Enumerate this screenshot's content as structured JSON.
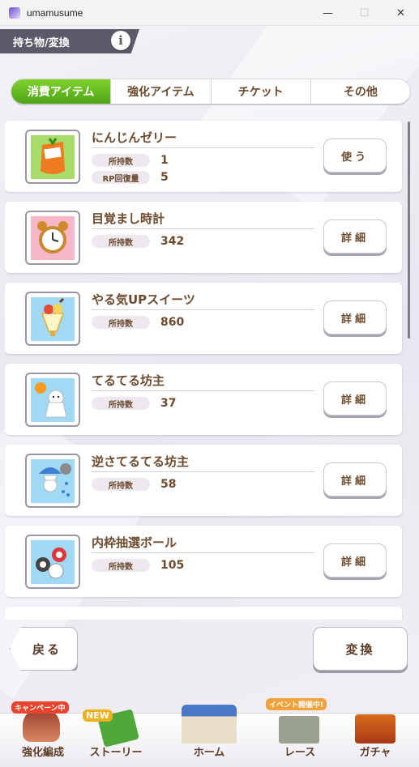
{
  "window": {
    "title": "umamusume",
    "minimize": "—",
    "maximize": "☐",
    "close": "✕"
  },
  "header": {
    "title": "持ち物/変換",
    "info": "i"
  },
  "tabs": [
    "消費アイテム",
    "強化アイテム",
    "チケット",
    "その他"
  ],
  "items": [
    {
      "name": "にんじんゼリー",
      "icon": "carrot-jelly-icon",
      "stats": [
        {
          "label": "所持数",
          "value": "1"
        },
        {
          "label": "RP回復量",
          "value": "5"
        }
      ],
      "button": "使う",
      "bg": "#a8dc6a"
    },
    {
      "name": "目覚まし時計",
      "icon": "alarm-clock-icon",
      "stats": [
        {
          "label": "所持数",
          "value": "342"
        }
      ],
      "button": "詳細",
      "bg": "#f6b7c8"
    },
    {
      "name": "やる気UPスイーツ",
      "icon": "parfait-icon",
      "stats": [
        {
          "label": "所持数",
          "value": "860"
        }
      ],
      "button": "詳細",
      "bg": "#9fd9f4"
    },
    {
      "name": "てるてる坊主",
      "icon": "teru-teru-bozu-icon",
      "stats": [
        {
          "label": "所持数",
          "value": "37"
        }
      ],
      "button": "詳細",
      "bg": "#9fd9f4"
    },
    {
      "name": "逆さてるてる坊主",
      "icon": "upside-down-teru-teru-bozu-icon",
      "stats": [
        {
          "label": "所持数",
          "value": "58"
        }
      ],
      "button": "詳細",
      "bg": "#9fd9f4"
    },
    {
      "name": "内枠抽選ボール",
      "icon": "lottery-balls-icon",
      "stats": [
        {
          "label": "所持数",
          "value": "105"
        }
      ],
      "button": "詳細",
      "bg": "#9fd9f4"
    }
  ],
  "actions": {
    "back": "戻る",
    "convert": "変換"
  },
  "nav": [
    {
      "label": "強化編成",
      "badge": "キャンペーン中"
    },
    {
      "label": "ストーリー",
      "badge": "NEW"
    },
    {
      "label": "ホーム",
      "badge": ""
    },
    {
      "label": "レース",
      "badge": "イベント開催中!"
    },
    {
      "label": "ガチャ",
      "badge": ""
    }
  ],
  "colors": {
    "accent_green": "#5fb41e",
    "text_brown": "#6b4a2e",
    "header_gray": "#5b5a68"
  }
}
